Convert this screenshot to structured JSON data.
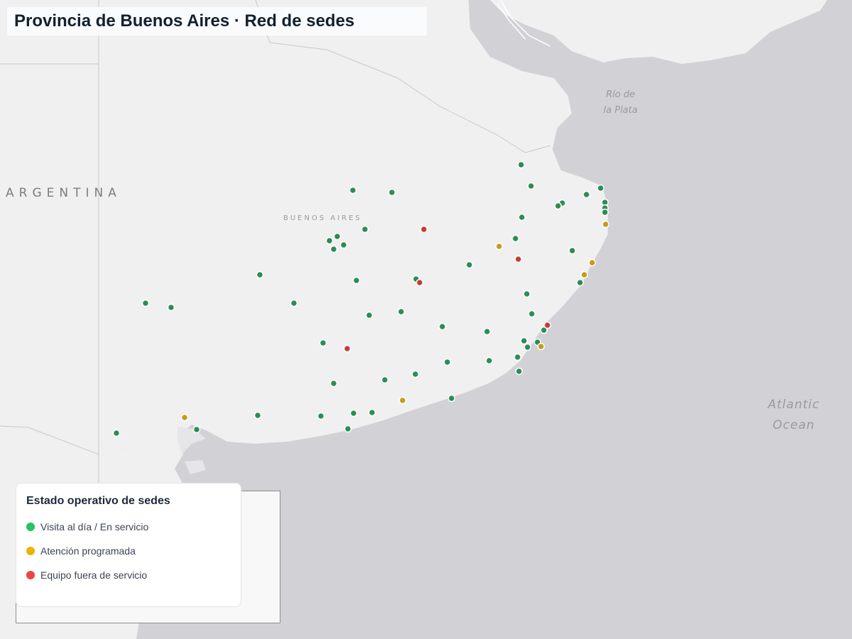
{
  "title": "Provincia de Buenos Aires · Red de sedes",
  "map_labels": {
    "country": "ARGENTINA",
    "province": "BUENOS AIRES",
    "river_line1": "Río de",
    "river_line2": "la Plata",
    "ocean_line1": "Atlantic",
    "ocean_line2": "Ocean"
  },
  "legend": {
    "title": "Estado operativo de sedes",
    "items": [
      {
        "label": "Visita al día / En servicio",
        "color": "#22c55e",
        "icon": "green-circle-icon"
      },
      {
        "label": "Atención programada",
        "color": "#eab308",
        "icon": "amber-circle-icon"
      },
      {
        "label": "Equipo fuera de servicio",
        "color": "#ef4444",
        "icon": "red-circle-icon"
      }
    ]
  },
  "colors": {
    "marker_ok": "#2e8b57",
    "marker_scheduled": "#c59b1a",
    "marker_down": "#c53b3b",
    "land": "#f0f0f0",
    "water": "#d2d1d6"
  }
}
